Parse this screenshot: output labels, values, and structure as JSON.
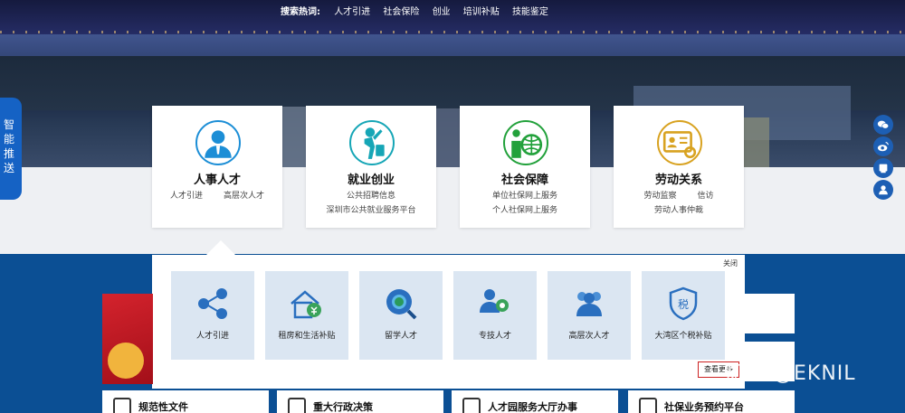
{
  "hot_search": {
    "label": "搜索热词:",
    "items": [
      "人才引进",
      "社会保险",
      "创业",
      "培训补贴",
      "技能鉴定"
    ]
  },
  "side_tag": {
    "text": "智能推送"
  },
  "cards": [
    {
      "title": "人事人才",
      "links": [
        "人才引进",
        "高层次人才"
      ],
      "rows": 1,
      "icon": "user-tie-icon",
      "color": "#1c8ed6"
    },
    {
      "title": "就业创业",
      "links": [
        "公共招聘信息",
        "深圳市公共就业服务平台"
      ],
      "rows": 2,
      "icon": "worker-icon",
      "color": "#16a6b6"
    },
    {
      "title": "社会保障",
      "links": [
        "单位社保网上服务",
        "个人社保网上服务"
      ],
      "rows": 2,
      "icon": "globe-person-icon",
      "color": "#22a13b"
    },
    {
      "title": "劳动关系",
      "links": [
        "劳动监察",
        "信访",
        "劳动人事仲裁"
      ],
      "rows": 2,
      "icon": "id-card-icon",
      "color": "#d8a220"
    }
  ],
  "panel": {
    "close_label": "关闭",
    "more_label": "查看更多",
    "tiles": [
      {
        "label": "人才引进",
        "icon": "network-people-icon"
      },
      {
        "label": "租房和生活补贴",
        "icon": "house-subsidy-icon"
      },
      {
        "label": "留学人才",
        "icon": "globe-search-icon"
      },
      {
        "label": "专技人才",
        "icon": "professional-team-icon"
      },
      {
        "label": "高层次人才",
        "icon": "senior-talent-icon"
      },
      {
        "label": "大湾区个税补贴",
        "icon": "tax-shield-icon"
      }
    ]
  },
  "bottom_cards": [
    {
      "label": "规范性文件",
      "icon": "document-icon"
    },
    {
      "label": "重大行政决策",
      "icon": "decision-icon"
    },
    {
      "label": "人才园服务大厅办事",
      "icon": "hall-icon"
    },
    {
      "label": "社保业务预约平台",
      "icon": "booking-icon"
    }
  ],
  "side_icons": [
    "wechat-icon",
    "weibo-icon",
    "mobile-icon",
    "user-service-icon"
  ],
  "watermark": {
    "text": "知乎 @EKNIL"
  },
  "colors": {
    "accent": "#1562c4",
    "band": "#0b4f94",
    "tile_bg": "#dbe6f2"
  }
}
